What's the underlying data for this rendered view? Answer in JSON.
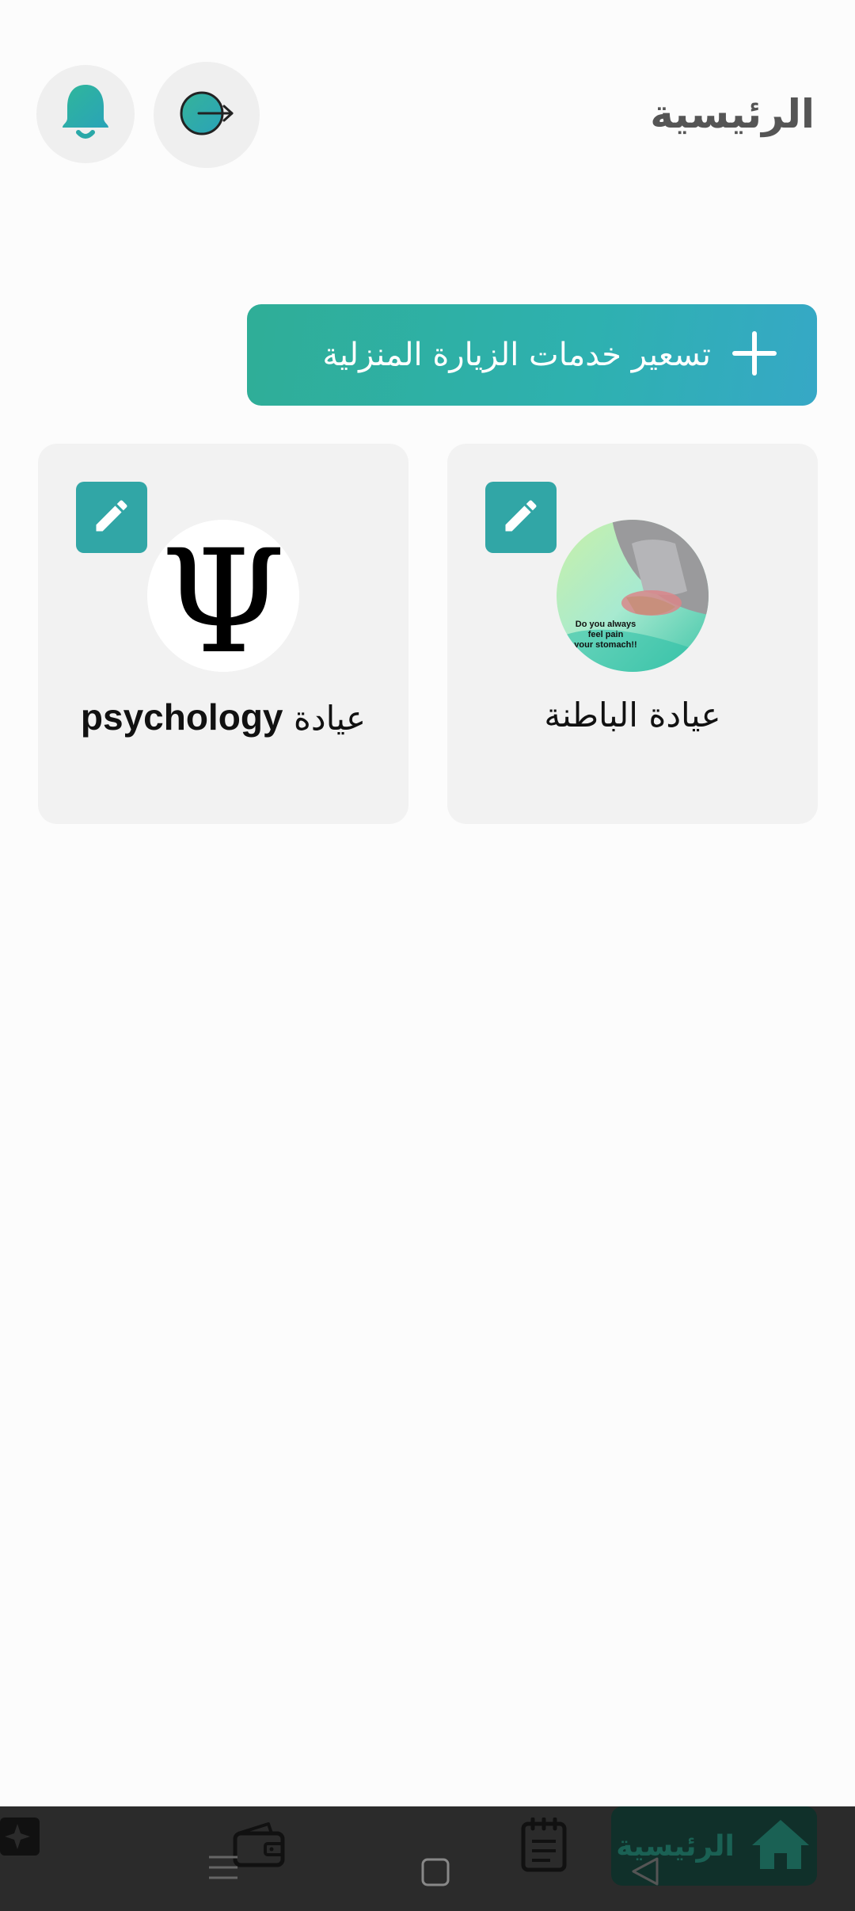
{
  "header": {
    "title": "الرئيسية",
    "notification_icon": "bell-icon",
    "logout_icon": "logout-icon"
  },
  "actions": {
    "price_home_visit_label": "تسعير خدمات الزيارة المنزلية",
    "price_home_visit_icon": "plus-icon"
  },
  "cards": [
    {
      "label_ar": "عيادة الباطنة",
      "image": "stomach-pain-photo",
      "image_text": [
        "Do you always",
        "feel pain",
        "your stomach!!"
      ],
      "edit_icon": "pencil-icon"
    },
    {
      "label_ar": "عيادة",
      "label_latin": "psychology",
      "image": "psi-symbol",
      "image_glyph": "Ψ",
      "edit_icon": "pencil-icon"
    }
  ],
  "bottom_nav": {
    "items": [
      {
        "icon": "home-icon",
        "label": "الرئيسية",
        "active": true
      },
      {
        "icon": "notepad-icon"
      },
      {
        "icon": "wallet-icon"
      },
      {
        "icon": "sparkle-icon"
      }
    ]
  },
  "colors": {
    "accent": "#31a6a6",
    "accent_gradient_start": "#2fae97",
    "accent_gradient_end": "#36a8c6",
    "card_bg": "#f2f2f2",
    "bottom_bar_bg": "#2b2b2b"
  }
}
